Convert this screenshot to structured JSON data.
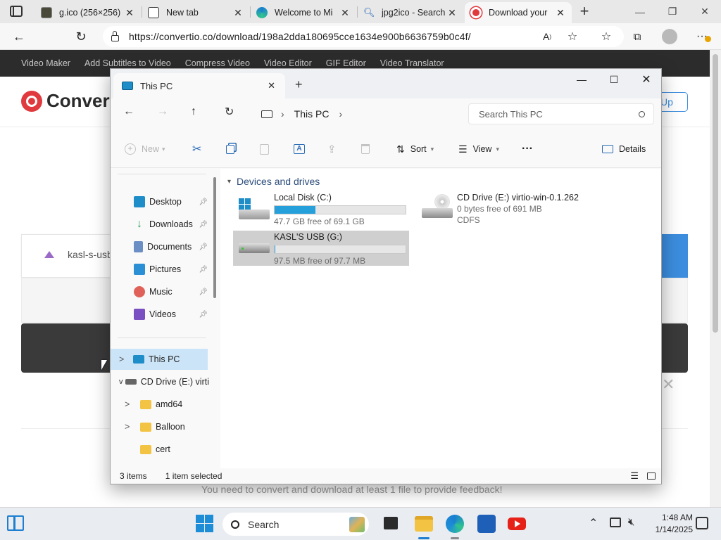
{
  "browser": {
    "tabs": [
      {
        "label": "g.ico (256×256)",
        "favicon_color": "#3a3a3a"
      },
      {
        "label": "New tab",
        "favicon_color": "#ffffff"
      },
      {
        "label": "Welcome to Mi",
        "favicon_color": "#1ba5c9"
      },
      {
        "label": "jpg2ico - Search",
        "favicon_color": "#ffffff"
      },
      {
        "label": "Download your",
        "favicon_color": "#e03a3e"
      }
    ],
    "url": "https://convertio.co/download/198a2dda180695cce1634e900b6636759b0c4f/",
    "new_tab_glyph": "+"
  },
  "site": {
    "nav_items": [
      "Video Maker",
      "Add Subtitles to Video",
      "Compress Video",
      "Video Editor",
      "GIF Editor",
      "Video Translator"
    ],
    "brand": "Convert",
    "signup_fragment": "Up",
    "file_name_fragment": "kasl-s-usb",
    "feedback_text": "You need to convert and download at least 1 file to provide feedback!"
  },
  "explorer": {
    "tab_title": "This PC",
    "breadcrumb": "This PC",
    "search_placeholder": "Search This PC",
    "commands": {
      "new": "New",
      "sort": "Sort",
      "view": "View",
      "details": "Details",
      "more": "···"
    },
    "nav_items": [
      {
        "label": "Desktop",
        "icon": "desktop-icon"
      },
      {
        "label": "Downloads",
        "icon": "download-icon"
      },
      {
        "label": "Documents",
        "icon": "documents-icon"
      },
      {
        "label": "Pictures",
        "icon": "pictures-icon"
      },
      {
        "label": "Music",
        "icon": "music-icon"
      },
      {
        "label": "Videos",
        "icon": "videos-icon"
      }
    ],
    "tree": [
      {
        "label": "This PC",
        "expander": ">"
      },
      {
        "label": "CD Drive (E:) virti",
        "expander": "v"
      },
      {
        "label": "amd64",
        "expander": ">"
      },
      {
        "label": "Balloon",
        "expander": ">"
      },
      {
        "label": "cert",
        "expander": ""
      }
    ],
    "group_header": "Devices and drives",
    "drives": [
      {
        "name": "Local Disk (C:)",
        "free": "47.7 GB free of 69.1 GB",
        "used_fraction": 0.31
      },
      {
        "name": "CD Drive (E:) virtio-win-0.1.262",
        "free": "0 bytes free of 691 MB",
        "fs": "CDFS"
      },
      {
        "name": "KASL'S USB (G:)",
        "free": "97.5 MB free of 97.7 MB",
        "used_fraction": 0.002
      }
    ],
    "status": {
      "items": "3 items",
      "selected": "1 item selected"
    }
  },
  "taskbar": {
    "search_label": "Search",
    "time": "1:48 AM",
    "date": "1/14/2025"
  }
}
